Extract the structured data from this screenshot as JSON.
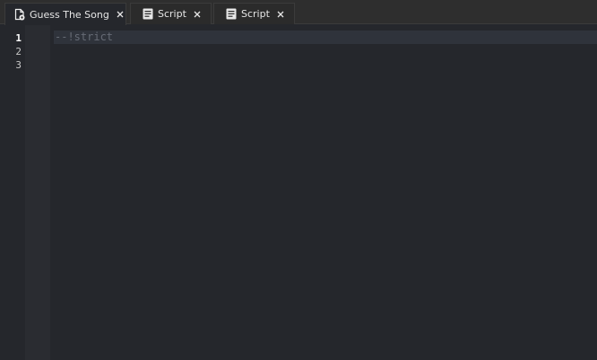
{
  "tabs": [
    {
      "label": "Guess The Song",
      "icon": "place-file-icon",
      "state": "active"
    },
    {
      "label": "Script",
      "icon": "script-icon",
      "state": "inactive"
    },
    {
      "label": "Script",
      "icon": "script-icon",
      "state": "inactive"
    }
  ],
  "editor": {
    "line_numbers": [
      "1",
      "2",
      "3"
    ],
    "current_line": "1",
    "lines": [
      "--!strict",
      "",
      ""
    ]
  },
  "colors": {
    "background": "#25272c",
    "current_line": "#2f333b",
    "comment": "#666b75"
  }
}
